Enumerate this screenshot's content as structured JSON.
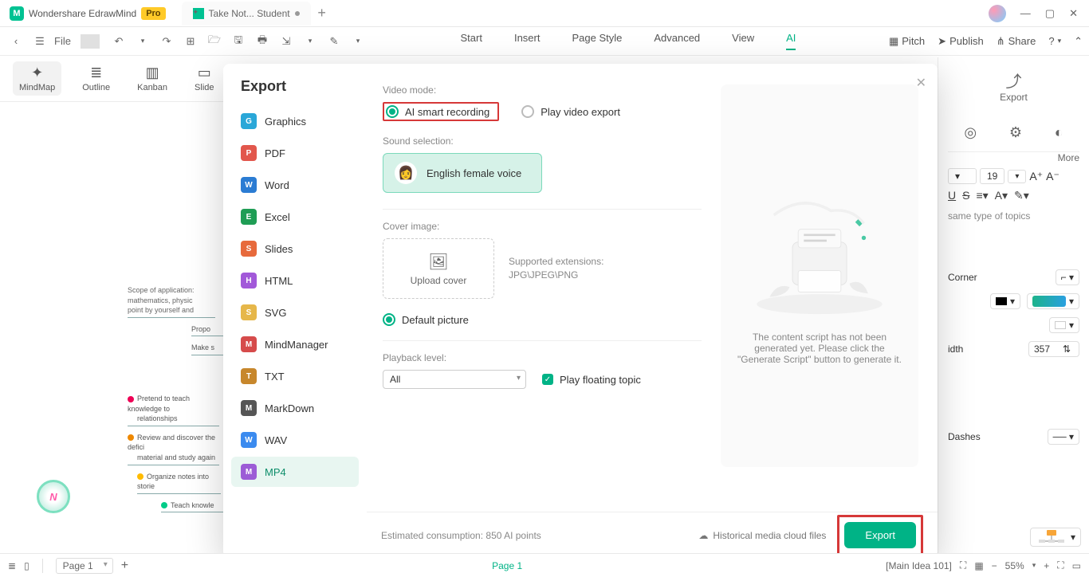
{
  "titlebar": {
    "app_name": "Wondershare EdrawMind",
    "pro_badge": "Pro",
    "doc_tab": "Take Not... Student",
    "win": {
      "min": "—",
      "max": "▢",
      "close": "✕"
    }
  },
  "maintb": {
    "file": "File",
    "menus": [
      "Start",
      "Insert",
      "Page Style",
      "Advanced",
      "View",
      "AI"
    ],
    "active_menu": 5,
    "pitch": "Pitch",
    "publish": "Publish",
    "share": "Share"
  },
  "viewbar": {
    "items": [
      {
        "label": "MindMap"
      },
      {
        "label": "Outline"
      },
      {
        "label": "Kanban"
      },
      {
        "label": "Slide"
      }
    ],
    "active": 0
  },
  "rightpanel": {
    "export_label": "Export",
    "more": "More",
    "font_size": "19",
    "same_type": "same type of topics",
    "corner": "Corner",
    "width_label": "idth",
    "width_val": "357",
    "dashes": "Dashes"
  },
  "export_dialog": {
    "title": "Export",
    "formats": [
      {
        "label": "Graphics",
        "color": "#2aa7d8"
      },
      {
        "label": "PDF",
        "color": "#e2574c"
      },
      {
        "label": "Word",
        "color": "#2b7cd3"
      },
      {
        "label": "Excel",
        "color": "#1f9d55"
      },
      {
        "label": "Slides",
        "color": "#e76a3c"
      },
      {
        "label": "HTML",
        "color": "#a259d9"
      },
      {
        "label": "SVG",
        "color": "#e6b74a"
      },
      {
        "label": "MindManager",
        "color": "#d64b4b"
      },
      {
        "label": "TXT",
        "color": "#c7872c"
      },
      {
        "label": "MarkDown",
        "color": "#555"
      },
      {
        "label": "WAV",
        "color": "#3b8bef"
      },
      {
        "label": "MP4",
        "color": "#9c5cd6"
      }
    ],
    "selected_format": 11,
    "video_mode_label": "Video mode:",
    "video_modes": [
      "AI smart recording",
      "Play video export"
    ],
    "video_mode_selected": 0,
    "sound_label": "Sound selection:",
    "voice_name": "English female voice",
    "cover_label": "Cover image:",
    "upload_cover": "Upload cover",
    "ext_top": "Supported extensions:",
    "ext_bottom": "JPG\\JPEG\\PNG",
    "default_pic": "Default picture",
    "playback_label": "Playback level:",
    "playback_value": "All",
    "play_floating": "Play floating topic",
    "preview_msg": "The content script has not been generated yet. Please click the \"Generate Script\" button to generate it.",
    "consumption": "Estimated consumption: 850 AI points",
    "cloud_files": "Historical media cloud files",
    "export_btn": "Export"
  },
  "mindmap_snippet": {
    "l1": "Scope of application:",
    "l2": "mathematics, physic",
    "l3": "point by yourself and",
    "l4": "Propo",
    "l5": "Make s",
    "l6": "Pretend to teach knowledge to",
    "l6b": "relationships",
    "l7": "Review and discover the defici",
    "l7b": "material and study again",
    "l8": "Organize notes into storie",
    "l9": "Teach knowle"
  },
  "statusbar": {
    "page_sel": "Page 1",
    "page_center": "Page 1",
    "idea": "[Main Idea 101]",
    "zoom": "55%"
  }
}
